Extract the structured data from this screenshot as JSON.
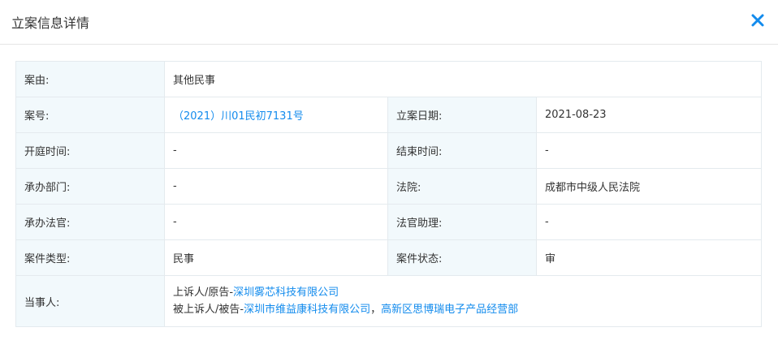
{
  "modal": {
    "title": "立案信息详情",
    "close_icon": "close-icon"
  },
  "rows": {
    "cause": {
      "label": "案由:",
      "value": "其他民事"
    },
    "case_no": {
      "label": "案号:",
      "value": "（2021）川01民初7131号"
    },
    "filing_date": {
      "label": "立案日期:",
      "value": "2021-08-23"
    },
    "hearing_time": {
      "label": "开庭时间:",
      "value": "-"
    },
    "end_time": {
      "label": "结束时间:",
      "value": "-"
    },
    "department": {
      "label": "承办部门:",
      "value": "-"
    },
    "court": {
      "label": "法院:",
      "value": "成都市中级人民法院"
    },
    "judge": {
      "label": "承办法官:",
      "value": "-"
    },
    "assistant": {
      "label": "法官助理:",
      "value": "-"
    },
    "case_type": {
      "label": "案件类型:",
      "value": "民事"
    },
    "case_status": {
      "label": "案件状态:",
      "value": "审"
    },
    "parties": {
      "label": "当事人:",
      "line1_prefix": "上诉人/原告-",
      "line1_link": "深圳雾芯科技有限公司",
      "line2_prefix": "被上诉人/被告-",
      "line2_link1": "深圳市维益康科技有限公司",
      "line2_sep": "，",
      "line2_link2": "高新区思博瑞电子产品经营部"
    }
  },
  "colors": {
    "link": "#128bed",
    "label_bg": "#f2f9fc",
    "border": "#e4eaee"
  }
}
